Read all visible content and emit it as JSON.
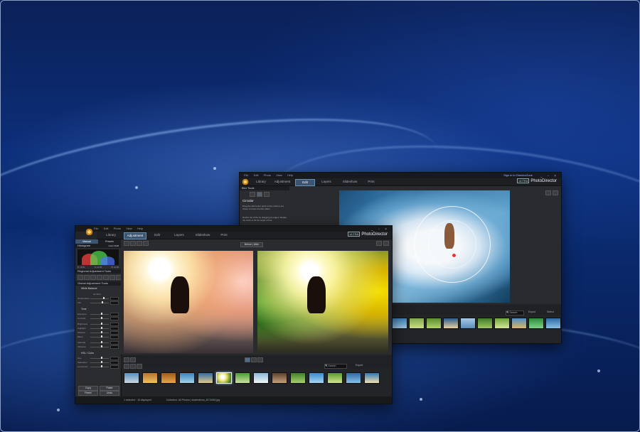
{
  "background": {
    "accent": "#0c2e79",
    "highlight": "#a0c8ff"
  },
  "back_window": {
    "menu": [
      "File",
      "Edit",
      "Photo",
      "View",
      "Help"
    ],
    "account_link": "Sign in to DirectorZone",
    "modes": [
      "Library",
      "Adjustment",
      "Edit",
      "Layers",
      "Slideshow",
      "Print"
    ],
    "active_mode": "Edit",
    "brand_badge": "ULTRA",
    "brand_name": "PhotoDirector",
    "panel_title": "Blur Tools",
    "panel_heading": "Circular",
    "panel_text_1": "Drag the slid center point to the circle to set where to focus the blur effect.",
    "panel_text_2": "Resize the circle by dragging its edges. Rotate the circle to tilt the angle of blur.",
    "show_mask": "Show mask",
    "search_label": "Search",
    "export_label": "Export",
    "select_label": "Select"
  },
  "front_window": {
    "menu": [
      "File",
      "Edit",
      "Photo",
      "View",
      "Help"
    ],
    "modes": [
      "Library",
      "Adjustment",
      "Edit",
      "Layers",
      "Slideshow",
      "Print"
    ],
    "active_mode": "Adjustment",
    "brand_badge": "ULTRA",
    "brand_name": "PhotoDirector",
    "sub_tabs": [
      "Manual",
      "Presets"
    ],
    "histogram_title": "Histogram",
    "histogram_modes": [
      "Color",
      "RGB"
    ],
    "histogram_readouts": [
      "R: 18.81",
      "G: 22.81",
      "B: 19.58"
    ],
    "regional_title": "Regional Adjustment Tools",
    "global_title": "Global Adjustment Tools",
    "sections": {
      "white_balance": "White Balance",
      "tone": "Tone",
      "hsl": "HSL / Color"
    },
    "sliders_wb": [
      "As Shot",
      "Temperature",
      "Tint"
    ],
    "sliders_tone": [
      "Exposure",
      "Contrast",
      "Brightness",
      "Highlight",
      "Shadow",
      "Black",
      "Saturate",
      "Vibrance"
    ],
    "sliders_hsl": [
      "Hue",
      "Saturation",
      "Luminance"
    ],
    "compare_label": "Before | After",
    "search_label": "Search",
    "export_label": "Export",
    "buttons": [
      "Copy",
      "Paste",
      "Reset",
      "Undo"
    ],
    "status": "1 selected · 16 displayed",
    "status_path": "Collection: All Photos | skaterdemo_8174645.jpg"
  }
}
